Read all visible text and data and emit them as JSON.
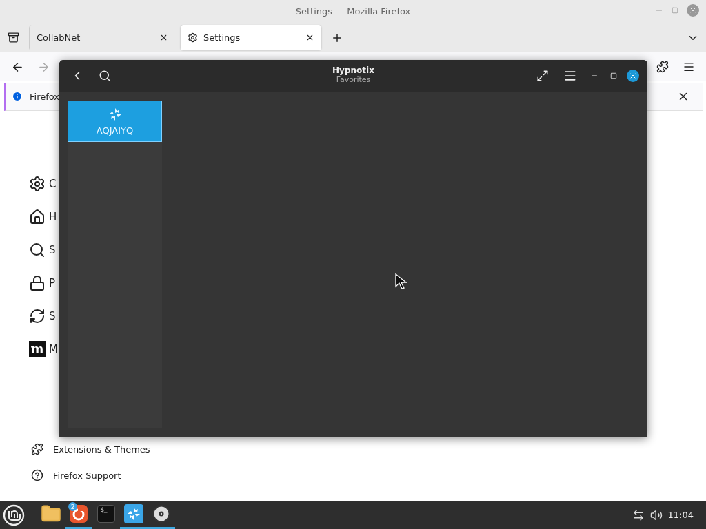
{
  "firefox": {
    "title": "Settings — Mozilla Firefox",
    "tabs": [
      {
        "label": "CollabNet",
        "selected": false
      },
      {
        "label": "Settings",
        "selected": true
      }
    ],
    "notification": {
      "text": "Firefox"
    },
    "sidebar": {
      "items": [
        {
          "kind": "gear",
          "label": "C"
        },
        {
          "kind": "home",
          "label": "H"
        },
        {
          "kind": "search",
          "label": "S"
        },
        {
          "kind": "lock",
          "label": "P"
        },
        {
          "kind": "sync",
          "label": "S"
        },
        {
          "kind": "logo",
          "logo_text": "m",
          "label": "M"
        }
      ],
      "footer": [
        {
          "kind": "puzzle",
          "label": "Extensions & Themes"
        },
        {
          "kind": "help",
          "label": "Firefox Support"
        }
      ]
    }
  },
  "hypnotix": {
    "title": "Hypnotix",
    "subtitle": "Favorites",
    "channels": [
      {
        "name": "AQJAIYQ",
        "selected": true
      }
    ]
  },
  "taskbar": {
    "apps": [
      {
        "kind": "files",
        "active": false
      },
      {
        "kind": "browser",
        "badge": "2",
        "active": true
      },
      {
        "kind": "terminal",
        "terminal_text": "$_",
        "active": false
      },
      {
        "kind": "hypnotix",
        "active": true
      },
      {
        "kind": "disc",
        "active": true
      }
    ],
    "clock": "11:04"
  }
}
